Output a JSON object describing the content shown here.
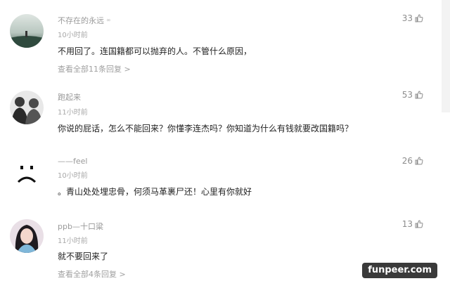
{
  "comments": [
    {
      "username": "不存在的永远",
      "time": "10小时前",
      "text": "不用回了。连国籍都可以抛弃的人。不管什么原因，",
      "likes": "33",
      "replies": "查看全部11条回复 >"
    },
    {
      "username": "跑起来",
      "time": "11小时前",
      "text": "你说的屁话，怎么不能回来？你懂李连杰吗？你知道为什么有钱就要改国籍吗？",
      "likes": "53"
    },
    {
      "username": "——feel",
      "time": "10小时前",
      "text": "。青山处处埋忠骨，何须马革裹尸还！心里有你就好",
      "likes": "26"
    },
    {
      "username": "ppb—十口粱",
      "time": "11小时前",
      "text": "就不要回来了",
      "likes": "13",
      "replies": "查看全部4条回复 >"
    }
  ],
  "watermark": "funpeer.com",
  "icons": {
    "like": "thumbs-up-icon"
  },
  "colors": {
    "text": "#222222",
    "meta": "#9a9a9a",
    "brand_bg": "#3a3a3a"
  }
}
